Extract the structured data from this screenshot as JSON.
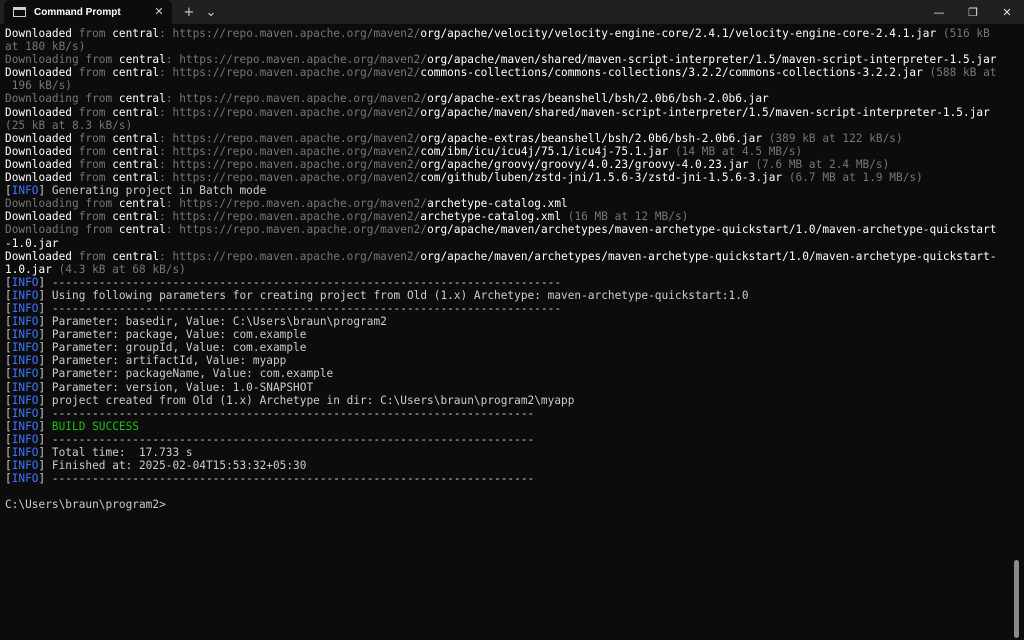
{
  "window": {
    "tab_title": "Command Prompt",
    "tab_icon": "terminal-icon",
    "new_tab": "+",
    "dropdown": "⌄",
    "close_tab": "✕",
    "controls": {
      "minimize": "—",
      "maximize": "❐",
      "close": "✕"
    }
  },
  "colors": {
    "background": "#0c0c0c",
    "info_tag": "#3b78ff",
    "success": "#16c60c",
    "dim": "#767676",
    "text": "#cccccc"
  },
  "console": {
    "lines": [
      [
        {
          "t": "Downloaded",
          "c": "dd"
        },
        {
          "t": " from ",
          "c": "dim"
        },
        {
          "t": "central",
          "c": "bold"
        },
        {
          "t": ": https://repo.maven.apache.org/maven2/",
          "c": "url"
        },
        {
          "t": "org/apache/velocity/velocity-engine-core/2.4.1/velocity-engine-core-2.4.1.jar",
          "c": "bold"
        },
        {
          "t": " (516 kB",
          "c": "dim"
        }
      ],
      [
        {
          "t": "at 180 kB/s)",
          "c": "dim"
        }
      ],
      [
        {
          "t": "Downloading",
          "c": "dl"
        },
        {
          "t": " from ",
          "c": "dim"
        },
        {
          "t": "central",
          "c": "bold"
        },
        {
          "t": ": https://repo.maven.apache.org/maven2/",
          "c": "url"
        },
        {
          "t": "org/apache/maven/shared/maven-script-interpreter/1.5/maven-script-interpreter-1.5.jar",
          "c": "bold"
        }
      ],
      [
        {
          "t": "Downloaded",
          "c": "dd"
        },
        {
          "t": " from ",
          "c": "dim"
        },
        {
          "t": "central",
          "c": "bold"
        },
        {
          "t": ": https://repo.maven.apache.org/maven2/",
          "c": "url"
        },
        {
          "t": "commons-collections/commons-collections/3.2.2/commons-collections-3.2.2.jar",
          "c": "bold"
        },
        {
          "t": " (588 kB at",
          "c": "dim"
        }
      ],
      [
        {
          "t": " 196 kB/s)",
          "c": "dim"
        }
      ],
      [
        {
          "t": "Downloading",
          "c": "dl"
        },
        {
          "t": " from ",
          "c": "dim"
        },
        {
          "t": "central",
          "c": "bold"
        },
        {
          "t": ": https://repo.maven.apache.org/maven2/",
          "c": "url"
        },
        {
          "t": "org/apache-extras/beanshell/bsh/2.0b6/bsh-2.0b6.jar",
          "c": "bold"
        }
      ],
      [
        {
          "t": "Downloaded",
          "c": "dd"
        },
        {
          "t": " from ",
          "c": "dim"
        },
        {
          "t": "central",
          "c": "bold"
        },
        {
          "t": ": https://repo.maven.apache.org/maven2/",
          "c": "url"
        },
        {
          "t": "org/apache/maven/shared/maven-script-interpreter/1.5/maven-script-interpreter-1.5.jar",
          "c": "bold"
        }
      ],
      [
        {
          "t": "(25 kB at 8.3 kB/s)",
          "c": "dim"
        }
      ],
      [
        {
          "t": "Downloaded",
          "c": "dd"
        },
        {
          "t": " from ",
          "c": "dim"
        },
        {
          "t": "central",
          "c": "bold"
        },
        {
          "t": ": https://repo.maven.apache.org/maven2/",
          "c": "url"
        },
        {
          "t": "org/apache-extras/beanshell/bsh/2.0b6/bsh-2.0b6.jar",
          "c": "bold"
        },
        {
          "t": " (389 kB at 122 kB/s)",
          "c": "dim"
        }
      ],
      [
        {
          "t": "Downloaded",
          "c": "dd"
        },
        {
          "t": " from ",
          "c": "dim"
        },
        {
          "t": "central",
          "c": "bold"
        },
        {
          "t": ": https://repo.maven.apache.org/maven2/",
          "c": "url"
        },
        {
          "t": "com/ibm/icu/icu4j/75.1/icu4j-75.1.jar",
          "c": "bold"
        },
        {
          "t": " (14 MB at 4.5 MB/s)",
          "c": "dim"
        }
      ],
      [
        {
          "t": "Downloaded",
          "c": "dd"
        },
        {
          "t": " from ",
          "c": "dim"
        },
        {
          "t": "central",
          "c": "bold"
        },
        {
          "t": ": https://repo.maven.apache.org/maven2/",
          "c": "url"
        },
        {
          "t": "org/apache/groovy/groovy/4.0.23/groovy-4.0.23.jar",
          "c": "bold"
        },
        {
          "t": " (7.6 MB at 2.4 MB/s)",
          "c": "dim"
        }
      ],
      [
        {
          "t": "Downloaded",
          "c": "dd"
        },
        {
          "t": " from ",
          "c": "dim"
        },
        {
          "t": "central",
          "c": "bold"
        },
        {
          "t": ": https://repo.maven.apache.org/maven2/",
          "c": "url"
        },
        {
          "t": "com/github/luben/zstd-jni/1.5.6-3/zstd-jni-1.5.6-3.jar",
          "c": "bold"
        },
        {
          "t": " (6.7 MB at 1.9 MB/s)",
          "c": "dim"
        }
      ],
      [
        {
          "t": "[",
          "c": "norm"
        },
        {
          "t": "INFO",
          "c": "info"
        },
        {
          "t": "] Generating project in Batch mode",
          "c": "norm"
        }
      ],
      [
        {
          "t": "Downloading",
          "c": "dl"
        },
        {
          "t": " from ",
          "c": "dim"
        },
        {
          "t": "central",
          "c": "bold"
        },
        {
          "t": ": https://repo.maven.apache.org/maven2/",
          "c": "url"
        },
        {
          "t": "archetype-catalog.xml",
          "c": "bold"
        }
      ],
      [
        {
          "t": "Downloaded",
          "c": "dd"
        },
        {
          "t": " from ",
          "c": "dim"
        },
        {
          "t": "central",
          "c": "bold"
        },
        {
          "t": ": https://repo.maven.apache.org/maven2/",
          "c": "url"
        },
        {
          "t": "archetype-catalog.xml",
          "c": "bold"
        },
        {
          "t": " (16 MB at 12 MB/s)",
          "c": "dim"
        }
      ],
      [
        {
          "t": "Downloading",
          "c": "dl"
        },
        {
          "t": " from ",
          "c": "dim"
        },
        {
          "t": "central",
          "c": "bold"
        },
        {
          "t": ": https://repo.maven.apache.org/maven2/",
          "c": "url"
        },
        {
          "t": "org/apache/maven/archetypes/maven-archetype-quickstart/1.0/maven-archetype-quickstart",
          "c": "bold"
        }
      ],
      [
        {
          "t": "-1.0.jar",
          "c": "bold"
        }
      ],
      [
        {
          "t": "Downloaded",
          "c": "dd"
        },
        {
          "t": " from ",
          "c": "dim"
        },
        {
          "t": "central",
          "c": "bold"
        },
        {
          "t": ": https://repo.maven.apache.org/maven2/",
          "c": "url"
        },
        {
          "t": "org/apache/maven/archetypes/maven-archetype-quickstart/1.0/maven-archetype-quickstart-",
          "c": "bold"
        }
      ],
      [
        {
          "t": "1.0.jar",
          "c": "bold"
        },
        {
          "t": " (4.3 kB at 68 kB/s)",
          "c": "dim"
        }
      ],
      [
        {
          "t": "[",
          "c": "norm"
        },
        {
          "t": "INFO",
          "c": "info"
        },
        {
          "t": "] ----------------------------------------------------------------------------",
          "c": "norm"
        }
      ],
      [
        {
          "t": "[",
          "c": "norm"
        },
        {
          "t": "INFO",
          "c": "info"
        },
        {
          "t": "] Using following parameters for creating project from Old (1.x) Archetype: maven-archetype-quickstart:1.0",
          "c": "norm"
        }
      ],
      [
        {
          "t": "[",
          "c": "norm"
        },
        {
          "t": "INFO",
          "c": "info"
        },
        {
          "t": "] ----------------------------------------------------------------------------",
          "c": "norm"
        }
      ],
      [
        {
          "t": "[",
          "c": "norm"
        },
        {
          "t": "INFO",
          "c": "info"
        },
        {
          "t": "] Parameter: basedir, Value: C:\\Users\\braun\\program2",
          "c": "norm"
        }
      ],
      [
        {
          "t": "[",
          "c": "norm"
        },
        {
          "t": "INFO",
          "c": "info"
        },
        {
          "t": "] Parameter: package, Value: com.example",
          "c": "norm"
        }
      ],
      [
        {
          "t": "[",
          "c": "norm"
        },
        {
          "t": "INFO",
          "c": "info"
        },
        {
          "t": "] Parameter: groupId, Value: com.example",
          "c": "norm"
        }
      ],
      [
        {
          "t": "[",
          "c": "norm"
        },
        {
          "t": "INFO",
          "c": "info"
        },
        {
          "t": "] Parameter: artifactId, Value: myapp",
          "c": "norm"
        }
      ],
      [
        {
          "t": "[",
          "c": "norm"
        },
        {
          "t": "INFO",
          "c": "info"
        },
        {
          "t": "] Parameter: packageName, Value: com.example",
          "c": "norm"
        }
      ],
      [
        {
          "t": "[",
          "c": "norm"
        },
        {
          "t": "INFO",
          "c": "info"
        },
        {
          "t": "] Parameter: version, Value: 1.0-SNAPSHOT",
          "c": "norm"
        }
      ],
      [
        {
          "t": "[",
          "c": "norm"
        },
        {
          "t": "INFO",
          "c": "info"
        },
        {
          "t": "] project created from Old (1.x) Archetype in dir: C:\\Users\\braun\\program2\\myapp",
          "c": "norm"
        }
      ],
      [
        {
          "t": "[",
          "c": "norm"
        },
        {
          "t": "INFO",
          "c": "info"
        },
        {
          "t": "] ------------------------------------------------------------------------",
          "c": "norm"
        }
      ],
      [
        {
          "t": "[",
          "c": "norm"
        },
        {
          "t": "INFO",
          "c": "info"
        },
        {
          "t": "] ",
          "c": "norm"
        },
        {
          "t": "BUILD SUCCESS",
          "c": "succ"
        }
      ],
      [
        {
          "t": "[",
          "c": "norm"
        },
        {
          "t": "INFO",
          "c": "info"
        },
        {
          "t": "] ------------------------------------------------------------------------",
          "c": "norm"
        }
      ],
      [
        {
          "t": "[",
          "c": "norm"
        },
        {
          "t": "INFO",
          "c": "info"
        },
        {
          "t": "] Total time:  17.733 s",
          "c": "norm"
        }
      ],
      [
        {
          "t": "[",
          "c": "norm"
        },
        {
          "t": "INFO",
          "c": "info"
        },
        {
          "t": "] Finished at: 2025-02-04T15:53:32+05:30",
          "c": "norm"
        }
      ],
      [
        {
          "t": "[",
          "c": "norm"
        },
        {
          "t": "INFO",
          "c": "info"
        },
        {
          "t": "] ------------------------------------------------------------------------",
          "c": "norm"
        }
      ],
      [
        {
          "t": "",
          "c": "norm"
        }
      ],
      [
        {
          "t": "C:\\Users\\braun\\program2>",
          "c": "norm"
        }
      ]
    ]
  }
}
